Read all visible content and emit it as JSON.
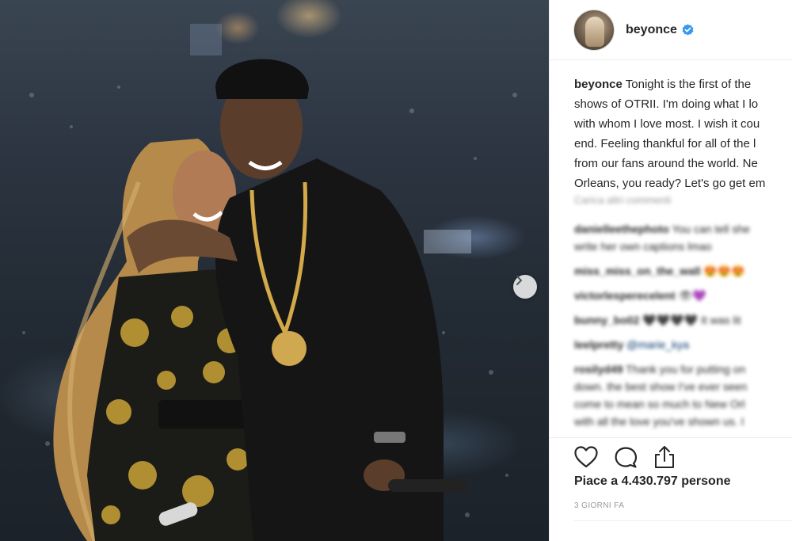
{
  "post": {
    "username": "beyonce",
    "verified": true,
    "caption_lines": [
      "Tonight is the first of the",
      "shows of OTRII. I'm doing what I lo",
      "with whom I love most. I wish it cou",
      "end. Feeling thankful for all of the l",
      "from our fans around the world. Ne",
      "Orleans, you ready? Let's go get em"
    ],
    "load_more": "Carica altri commenti",
    "comments": [
      {
        "user": "danielleethephoto",
        "text": "You can tell she"
      },
      {
        "user": "",
        "text": "write her own captions lmao"
      },
      {
        "user": "miss_miss_on_the_wall",
        "text": "😍😍😍"
      },
      {
        "user": "victorlesperecelent",
        "text": "👁💜"
      },
      {
        "user": "bunny_bo02",
        "text": "🖤🖤🖤🖤 It was lit"
      },
      {
        "user": "leelpretty",
        "text": "",
        "mention": "@marie_kya"
      },
      {
        "user": "rosilyd49",
        "text": "Thank you for putting on"
      },
      {
        "user": "",
        "text": "down. the best show I've ever seen"
      },
      {
        "user": "",
        "text": "come to mean so much to New Orl"
      },
      {
        "user": "",
        "text": "with all the love you've shown us. I"
      }
    ],
    "likes_prefix": "Piace a ",
    "likes_count": "4.430.797",
    "likes_suffix": " persone",
    "timestamp": "3 GIORNI FA"
  },
  "icons": {
    "verified": "verified-badge-icon",
    "like": "heart-icon",
    "comment": "comment-bubble-icon",
    "share": "share-icon",
    "next": "chevron-right-icon"
  },
  "colors": {
    "verified_blue": "#3897f0",
    "text": "#262626",
    "muted": "#999999",
    "divider": "#efefef"
  }
}
